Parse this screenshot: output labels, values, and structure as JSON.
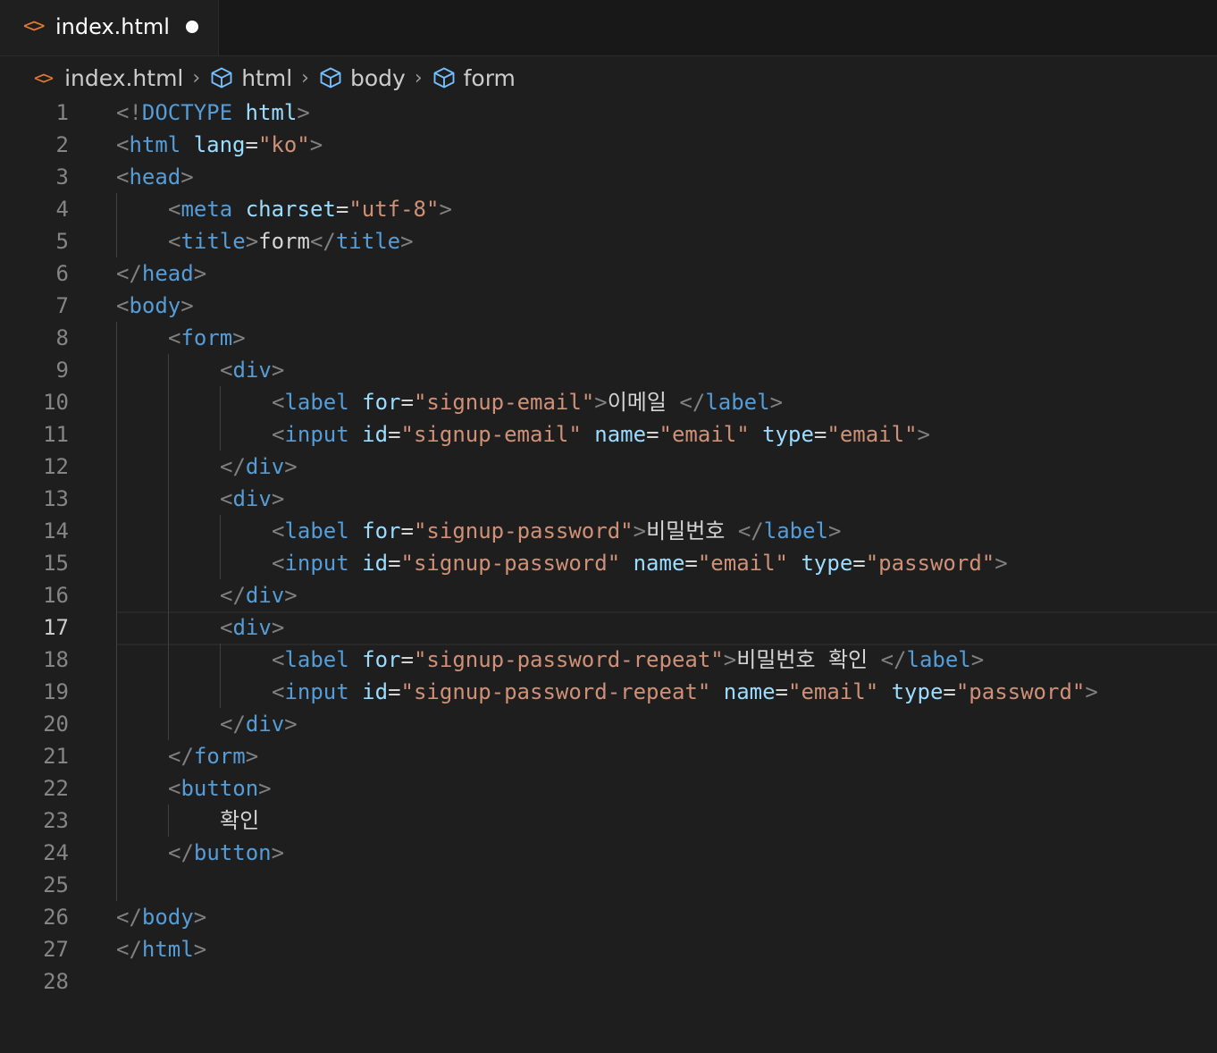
{
  "tab": {
    "icon": "<>",
    "filename": "index.html",
    "modified": true
  },
  "breadcrumb": {
    "file_icon": "<>",
    "items": [
      "index.html",
      "html",
      "body",
      "form"
    ]
  },
  "editor": {
    "active_line": 17,
    "lines": [
      {
        "n": "1",
        "indent": 0,
        "tokens": [
          [
            "pun",
            "<!"
          ],
          [
            "dt",
            "DOCTYPE"
          ],
          [
            "txt",
            " "
          ],
          [
            "att",
            "html"
          ],
          [
            "pun",
            ">"
          ]
        ]
      },
      {
        "n": "2",
        "indent": 0,
        "tokens": [
          [
            "pun",
            "<"
          ],
          [
            "tag",
            "html"
          ],
          [
            "txt",
            " "
          ],
          [
            "att",
            "lang"
          ],
          [
            "txt",
            "="
          ],
          [
            "str",
            "\"ko\""
          ],
          [
            "pun",
            ">"
          ]
        ]
      },
      {
        "n": "3",
        "indent": 0,
        "tokens": [
          [
            "pun",
            "<"
          ],
          [
            "tag",
            "head"
          ],
          [
            "pun",
            ">"
          ]
        ]
      },
      {
        "n": "4",
        "indent": 1,
        "tokens": [
          [
            "pun",
            "<"
          ],
          [
            "tag",
            "meta"
          ],
          [
            "txt",
            " "
          ],
          [
            "att",
            "charset"
          ],
          [
            "txt",
            "="
          ],
          [
            "str",
            "\"utf-8\""
          ],
          [
            "pun",
            ">"
          ]
        ]
      },
      {
        "n": "5",
        "indent": 1,
        "tokens": [
          [
            "pun",
            "<"
          ],
          [
            "tag",
            "title"
          ],
          [
            "pun",
            ">"
          ],
          [
            "txt",
            "form"
          ],
          [
            "pun",
            "</"
          ],
          [
            "tag",
            "title"
          ],
          [
            "pun",
            ">"
          ]
        ]
      },
      {
        "n": "6",
        "indent": 0,
        "tokens": [
          [
            "pun",
            "</"
          ],
          [
            "tag",
            "head"
          ],
          [
            "pun",
            ">"
          ]
        ]
      },
      {
        "n": "7",
        "indent": 0,
        "tokens": [
          [
            "pun",
            "<"
          ],
          [
            "tag",
            "body"
          ],
          [
            "pun",
            ">"
          ]
        ]
      },
      {
        "n": "8",
        "indent": 1,
        "tokens": [
          [
            "pun",
            "<"
          ],
          [
            "tag",
            "form"
          ],
          [
            "pun",
            ">"
          ]
        ]
      },
      {
        "n": "9",
        "indent": 2,
        "tokens": [
          [
            "pun",
            "<"
          ],
          [
            "tag",
            "div"
          ],
          [
            "pun",
            ">"
          ]
        ]
      },
      {
        "n": "10",
        "indent": 3,
        "tokens": [
          [
            "pun",
            "<"
          ],
          [
            "tag",
            "label"
          ],
          [
            "txt",
            " "
          ],
          [
            "att",
            "for"
          ],
          [
            "txt",
            "="
          ],
          [
            "str",
            "\"signup-email\""
          ],
          [
            "pun",
            ">"
          ],
          [
            "txt",
            "이메일 "
          ],
          [
            "pun",
            "</"
          ],
          [
            "tag",
            "label"
          ],
          [
            "pun",
            ">"
          ]
        ]
      },
      {
        "n": "11",
        "indent": 3,
        "tokens": [
          [
            "pun",
            "<"
          ],
          [
            "tag",
            "input"
          ],
          [
            "txt",
            " "
          ],
          [
            "att",
            "id"
          ],
          [
            "txt",
            "="
          ],
          [
            "str",
            "\"signup-email\""
          ],
          [
            "txt",
            " "
          ],
          [
            "att",
            "name"
          ],
          [
            "txt",
            "="
          ],
          [
            "str",
            "\"email\""
          ],
          [
            "txt",
            " "
          ],
          [
            "att",
            "type"
          ],
          [
            "txt",
            "="
          ],
          [
            "str",
            "\"email\""
          ],
          [
            "pun",
            ">"
          ]
        ]
      },
      {
        "n": "12",
        "indent": 2,
        "tokens": [
          [
            "pun",
            "</"
          ],
          [
            "tag",
            "div"
          ],
          [
            "pun",
            ">"
          ]
        ]
      },
      {
        "n": "13",
        "indent": 2,
        "tokens": [
          [
            "pun",
            "<"
          ],
          [
            "tag",
            "div"
          ],
          [
            "pun",
            ">"
          ]
        ]
      },
      {
        "n": "14",
        "indent": 3,
        "tokens": [
          [
            "pun",
            "<"
          ],
          [
            "tag",
            "label"
          ],
          [
            "txt",
            " "
          ],
          [
            "att",
            "for"
          ],
          [
            "txt",
            "="
          ],
          [
            "str",
            "\"signup-password\""
          ],
          [
            "pun",
            ">"
          ],
          [
            "txt",
            "비밀번호 "
          ],
          [
            "pun",
            "</"
          ],
          [
            "tag",
            "label"
          ],
          [
            "pun",
            ">"
          ]
        ]
      },
      {
        "n": "15",
        "indent": 3,
        "tokens": [
          [
            "pun",
            "<"
          ],
          [
            "tag",
            "input"
          ],
          [
            "txt",
            " "
          ],
          [
            "att",
            "id"
          ],
          [
            "txt",
            "="
          ],
          [
            "str",
            "\"signup-password\""
          ],
          [
            "txt",
            " "
          ],
          [
            "att",
            "name"
          ],
          [
            "txt",
            "="
          ],
          [
            "str",
            "\"email\""
          ],
          [
            "txt",
            " "
          ],
          [
            "att",
            "type"
          ],
          [
            "txt",
            "="
          ],
          [
            "str",
            "\"password\""
          ],
          [
            "pun",
            ">"
          ]
        ]
      },
      {
        "n": "16",
        "indent": 2,
        "tokens": [
          [
            "pun",
            "</"
          ],
          [
            "tag",
            "div"
          ],
          [
            "pun",
            ">"
          ]
        ]
      },
      {
        "n": "17",
        "indent": 2,
        "tokens": [
          [
            "pun",
            "<"
          ],
          [
            "tag",
            "div"
          ],
          [
            "pun",
            ">"
          ]
        ]
      },
      {
        "n": "18",
        "indent": 3,
        "tokens": [
          [
            "pun",
            "<"
          ],
          [
            "tag",
            "label"
          ],
          [
            "txt",
            " "
          ],
          [
            "att",
            "for"
          ],
          [
            "txt",
            "="
          ],
          [
            "str",
            "\"signup-password-repeat\""
          ],
          [
            "pun",
            ">"
          ],
          [
            "txt",
            "비밀번호 확인 "
          ],
          [
            "pun",
            "</"
          ],
          [
            "tag",
            "label"
          ],
          [
            "pun",
            ">"
          ]
        ]
      },
      {
        "n": "19",
        "indent": 3,
        "tokens": [
          [
            "pun",
            "<"
          ],
          [
            "tag",
            "input"
          ],
          [
            "txt",
            " "
          ],
          [
            "att",
            "id"
          ],
          [
            "txt",
            "="
          ],
          [
            "str",
            "\"signup-password-repeat\""
          ],
          [
            "txt",
            " "
          ],
          [
            "att",
            "name"
          ],
          [
            "txt",
            "="
          ],
          [
            "str",
            "\"email\""
          ],
          [
            "txt",
            " "
          ],
          [
            "att",
            "type"
          ],
          [
            "txt",
            "="
          ],
          [
            "str",
            "\"password\""
          ],
          [
            "pun",
            ">"
          ]
        ]
      },
      {
        "n": "20",
        "indent": 2,
        "tokens": [
          [
            "pun",
            "</"
          ],
          [
            "tag",
            "div"
          ],
          [
            "pun",
            ">"
          ]
        ]
      },
      {
        "n": "21",
        "indent": 1,
        "tokens": [
          [
            "pun",
            "</"
          ],
          [
            "tag",
            "form"
          ],
          [
            "pun",
            ">"
          ]
        ]
      },
      {
        "n": "22",
        "indent": 1,
        "tokens": [
          [
            "pun",
            "<"
          ],
          [
            "tag",
            "button"
          ],
          [
            "pun",
            ">"
          ]
        ]
      },
      {
        "n": "23",
        "indent": 2,
        "tokens": [
          [
            "txt",
            "확인"
          ]
        ]
      },
      {
        "n": "24",
        "indent": 1,
        "tokens": [
          [
            "pun",
            "</"
          ],
          [
            "tag",
            "button"
          ],
          [
            "pun",
            ">"
          ]
        ]
      },
      {
        "n": "25",
        "indent": 0,
        "tokens": []
      },
      {
        "n": "26",
        "indent": 0,
        "tokens": [
          [
            "pun",
            "</"
          ],
          [
            "tag",
            "body"
          ],
          [
            "pun",
            ">"
          ]
        ]
      },
      {
        "n": "27",
        "indent": 0,
        "tokens": [
          [
            "pun",
            "</"
          ],
          [
            "tag",
            "html"
          ],
          [
            "pun",
            ">"
          ]
        ]
      },
      {
        "n": "28",
        "indent": 0,
        "tokens": []
      }
    ]
  },
  "colors": {
    "background": "#1e1e1e",
    "tag": "#569cd6",
    "attribute": "#9cdcfe",
    "string": "#ce9178",
    "punctuation": "#808080",
    "file_icon": "#e37933"
  }
}
